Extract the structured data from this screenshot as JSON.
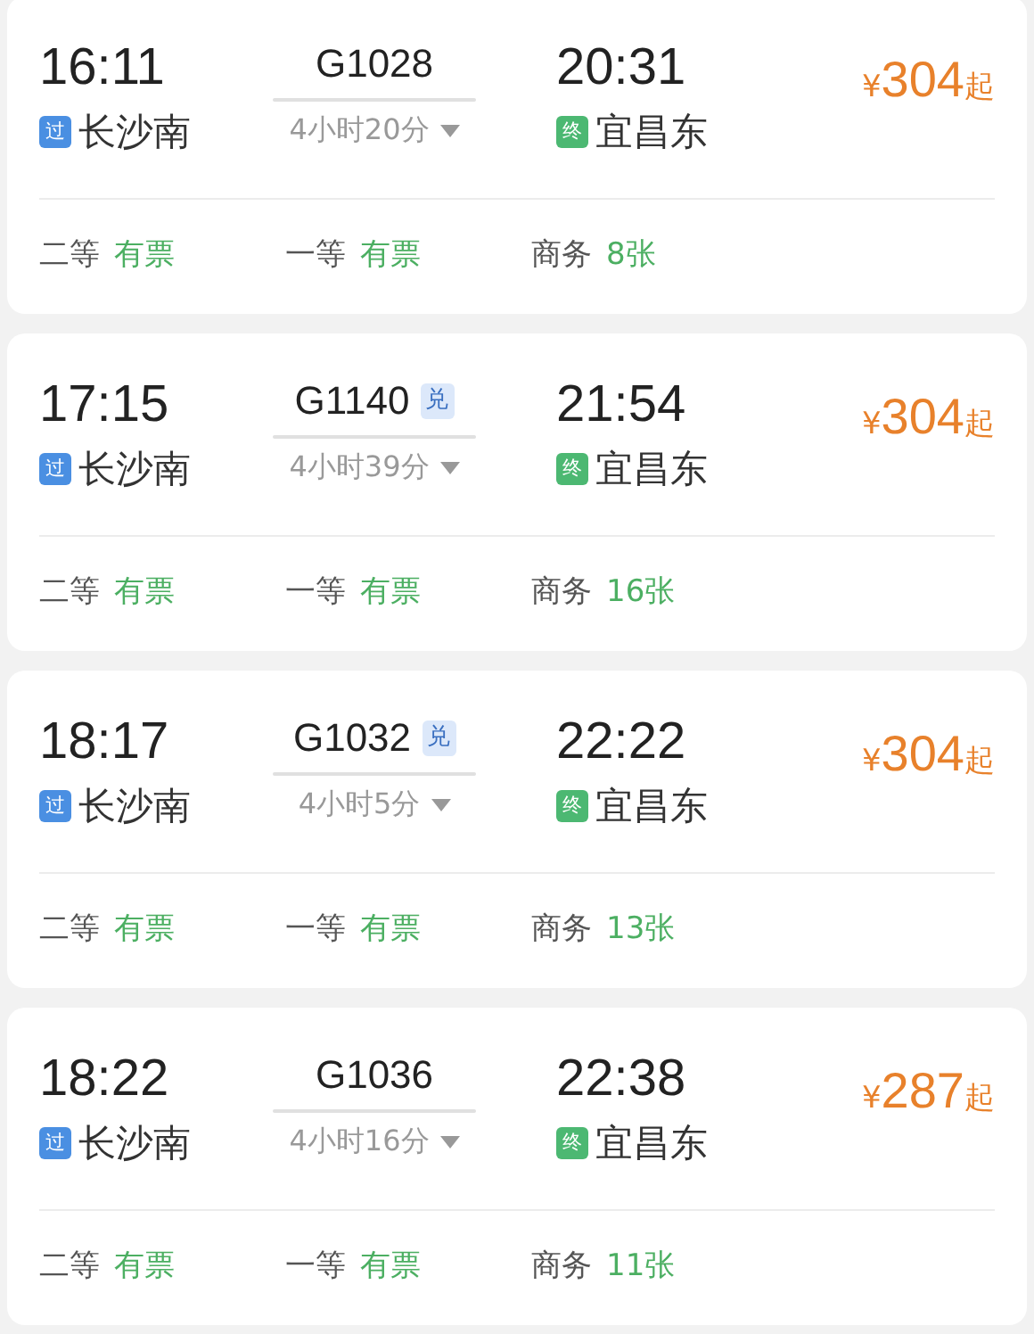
{
  "trains": [
    {
      "depart_time": "16:11",
      "depart_tag": {
        "text": "过",
        "color": "#4a8fe2"
      },
      "depart_station": "长沙南",
      "train_no": "G1028",
      "duration": "4小时20分",
      "arrive_time": "20:31",
      "arrive_tag": {
        "text": "终",
        "color": "#4cb872"
      },
      "arrive_station": "宜昌东",
      "currency": "¥",
      "price": "304",
      "price_suffix": "起",
      "seats": [
        {
          "class": "二等",
          "availability": "有票"
        },
        {
          "class": "一等",
          "availability": "有票"
        },
        {
          "class": "商务",
          "availability": "8张"
        }
      ]
    },
    {
      "depart_time": "17:15",
      "depart_tag": {
        "text": "过",
        "color": "#4a8fe2"
      },
      "depart_station": "长沙南",
      "train_no": "G1140",
      "badge": "兑",
      "duration": "4小时39分",
      "arrive_time": "21:54",
      "arrive_tag": {
        "text": "终",
        "color": "#4cb872"
      },
      "arrive_station": "宜昌东",
      "currency": "¥",
      "price": "304",
      "price_suffix": "起",
      "seats": [
        {
          "class": "二等",
          "availability": "有票"
        },
        {
          "class": "一等",
          "availability": "有票"
        },
        {
          "class": "商务",
          "availability": "16张"
        }
      ]
    },
    {
      "depart_time": "18:17",
      "depart_tag": {
        "text": "过",
        "color": "#4a8fe2"
      },
      "depart_station": "长沙南",
      "train_no": "G1032",
      "badge": "兑",
      "duration": "4小时5分",
      "arrive_time": "22:22",
      "arrive_tag": {
        "text": "终",
        "color": "#4cb872"
      },
      "arrive_station": "宜昌东",
      "currency": "¥",
      "price": "304",
      "price_suffix": "起",
      "seats": [
        {
          "class": "二等",
          "availability": "有票"
        },
        {
          "class": "一等",
          "availability": "有票"
        },
        {
          "class": "商务",
          "availability": "13张"
        }
      ]
    },
    {
      "depart_time": "18:22",
      "depart_tag": {
        "text": "过",
        "color": "#4a8fe2"
      },
      "depart_station": "长沙南",
      "train_no": "G1036",
      "duration": "4小时16分",
      "arrive_time": "22:38",
      "arrive_tag": {
        "text": "终",
        "color": "#4cb872"
      },
      "arrive_station": "宜昌东",
      "currency": "¥",
      "price": "287",
      "price_suffix": "起",
      "seats": [
        {
          "class": "二等",
          "availability": "有票"
        },
        {
          "class": "一等",
          "availability": "有票"
        },
        {
          "class": "商务",
          "availability": "11张"
        }
      ]
    }
  ]
}
